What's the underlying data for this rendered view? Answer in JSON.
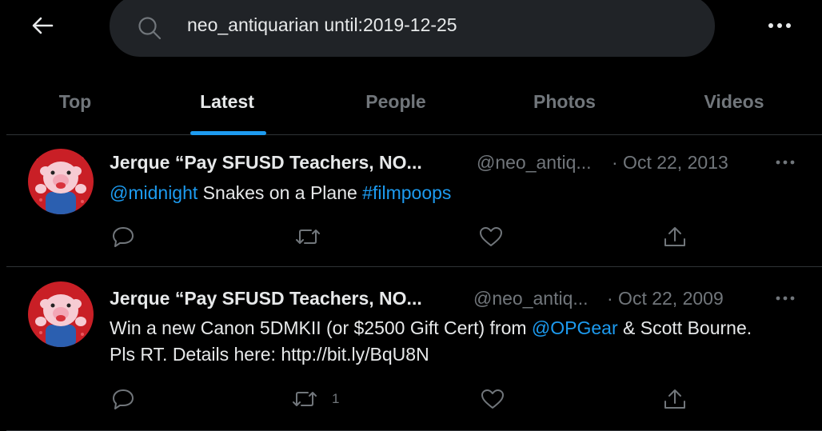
{
  "header": {
    "back_icon": "arrow-left-icon",
    "search": {
      "value": "neo_antiquarian until:2019-12-25",
      "icon": "search-icon"
    },
    "more_icon": "more-horizontal-icon"
  },
  "tabs": [
    {
      "label": "Top",
      "active": false
    },
    {
      "label": "Latest",
      "active": true
    },
    {
      "label": "People",
      "active": false
    },
    {
      "label": "Photos",
      "active": false
    },
    {
      "label": "Videos",
      "active": false
    }
  ],
  "tweets": [
    {
      "display_name": "Jerque “Pay SFUSD Teachers, NO...",
      "handle": "@neo_antiq...",
      "date": "· Oct 22, 2013",
      "body": {
        "mention": "@midnight",
        "text": " Snakes on a Plane ",
        "hashtag": "#filmpoops"
      },
      "actions": {
        "reply_count": "",
        "retweet_count": "",
        "like_count": ""
      }
    },
    {
      "display_name": "Jerque “Pay SFUSD Teachers, NO...",
      "handle": "@neo_antiq...",
      "date": "· Oct 22, 2009",
      "body": {
        "text_before": "Win a new Canon 5DMKII (or $2500 Gift Cert) from ",
        "mention": "@OPGear",
        "text_after": " & Scott Bourne. Pls RT. Details here: http://bit.ly/BqU8N"
      },
      "actions": {
        "reply_count": "",
        "retweet_count": "1",
        "like_count": ""
      }
    }
  ],
  "colors": {
    "background": "#000000",
    "accent": "#1d9bf0",
    "text": "#e7e9ea",
    "muted": "#71767b",
    "search_bg": "#202327",
    "divider": "#2f3336"
  }
}
